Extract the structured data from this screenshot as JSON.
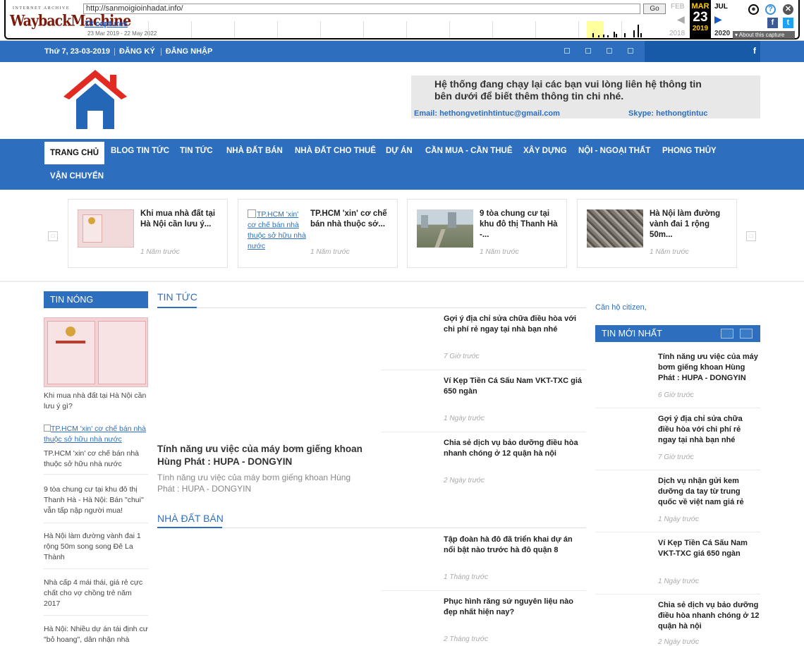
{
  "wayback": {
    "ia_label": "INTERNET ARCHIVE",
    "logo_text": "WaybackMachine",
    "url": "http://sanmoigioinhadat.info/",
    "go_label": "Go",
    "captures": "78 captures",
    "date_range": "23 Mar 2019 - 22 May 2022",
    "prev_month": "FEB",
    "cur_month": "MAR",
    "cur_day": "23",
    "next_month": "JUL",
    "prev_year": "2018",
    "cur_year": "2019",
    "next_year": "2020",
    "about": "About this capture",
    "icons": [
      "user-icon",
      "help-icon",
      "close-icon",
      "facebook-icon",
      "twitter-icon"
    ]
  },
  "topbar": {
    "date": "Thứ 7, 23-03-2019",
    "register": "ĐĂNG KÝ",
    "login": "ĐĂNG NHẬP",
    "search_icon": "f"
  },
  "banner": {
    "message": "Hệ thống đang chạy lại các bạn vui lòng liên hệ thông tin bên dưới để biết thêm thông tin chi nhé.",
    "email": "Email: hethongvetinhtintuc@gmail.com",
    "skype": "Skype: hethongtintuc"
  },
  "nav": {
    "items": [
      "TRANG CHỦ",
      "BLOG TIN TỨC",
      "TIN TỨC",
      "NHÀ ĐẤT BÁN",
      "NHÀ ĐẤT CHO THUÊ",
      "DỰ ÁN",
      "CẦN MUA - CẦN THUÊ",
      "XÂY DỰNG",
      "NỘI - NGOẠI THẤT",
      "PHONG THỦY",
      "VẬN CHUYỂN"
    ]
  },
  "carousel": [
    {
      "title": "Khi mua nhà đất tại Hà Nội cần lưu ý...",
      "time": "1 Năm trước"
    },
    {
      "alt": "TP.HCM 'xin' cơ chế bán nhà thuộc sở hữu nhà nước",
      "title": "TP.HCM 'xin' cơ chế bán nhà thuộc sở...",
      "time": "1 Năm trước"
    },
    {
      "title": "9 tòa chung cư tại khu đô thị Thanh Hà -...",
      "time": "1 Năm trước"
    },
    {
      "title": "Hà Nội làm đường vành đai 1 rộng 50m...",
      "time": "1 Năm trước"
    }
  ],
  "left": {
    "heading": "TIN NÓNG",
    "items": [
      "Khi mua nhà đất tại Hà Nội cần lưu ý gì?",
      "TP.HCM 'xin' cơ chế bán nhà thuộc sở hữu nhà nước",
      "TP.HCM 'xin' cơ chế bán nhà thuộc sở hữu nhà nước",
      "9 tòa chung cư tại khu đô thị Thanh Hà - Hà Nội: Bán \"chui\" vẫn tấp nập người mua!",
      "Hà Nội làm đường vành đai 1 rộng 50m song song Đê La Thành",
      "Nhà cấp 4 mái thái, giá rẻ cực chất cho vợ chồng trẻ năm 2017",
      "Hà Nội: Nhiều dự án tái định cư \"bỏ hoang\", dân nhận nhà"
    ]
  },
  "middle": {
    "section1": "TIN TỨC",
    "big_title": "Tính năng ưu việc của máy bơm giếng khoan Hùng Phát : HUPA - DONGYIN",
    "big_desc": "Tính năng ưu việc của máy bơm giếng khoan Hùng Phát : HUPA - DONGYIN",
    "posts1": [
      {
        "title": "Gợi ý địa chỉ sửa chữa điều hòa với chi phí rẻ ngay tại nhà bạn nhé",
        "time": "7 Giờ trước"
      },
      {
        "title": "Ví Kẹp Tiền Cá Sấu Nam VKT-TXC giá 650 ngàn",
        "time": "1 Ngày trước"
      },
      {
        "title": "Chia sẻ dịch vụ bảo dưỡng điều hòa nhanh chóng ở 12 quận hà nội",
        "time": "2 Ngày trước"
      }
    ],
    "section2": "NHÀ ĐẤT BÁN",
    "posts2": [
      {
        "title": "Tập đoàn hà đô đã triển khai dự án nổi bật nào trước hà đô quận 8",
        "time": "1 Tháng trước"
      },
      {
        "title": "Phục hình răng sứ nguyên liệu nào đẹp nhất hiện nay?",
        "time": "2 Tháng trước"
      }
    ]
  },
  "right": {
    "citizen": "Căn hộ citizen,",
    "heading": "TIN MỚI NHẤT",
    "posts": [
      {
        "title": "Tính năng ưu việc của máy bơm giếng khoan Hùng Phát : HUPA - DONGYIN",
        "time": "6 Giờ trước"
      },
      {
        "title": "Gợi ý địa chỉ sửa chữa điều hòa với chi phí rẻ ngay tại nhà bạn nhé",
        "time": "7 Giờ trước"
      },
      {
        "title": "Dịch vụ nhận gửi kem dưỡng da tay từ trung quốc về việt nam giá rẻ",
        "time": "1 Ngày trước"
      },
      {
        "title": "Ví Kẹp Tiền Cá Sấu Nam VKT-TXC giá 650 ngàn",
        "time": "1 Ngày trước"
      },
      {
        "title": "Chia sẻ dịch vụ bảo dưỡng điều hòa nhanh chóng ở 12 quận hà nội",
        "time": "2 Ngày trước"
      }
    ]
  },
  "colors": {
    "brand_blue": "#2d6fbe",
    "roof_red": "#e02a22",
    "wayback_yellow": "#ffcc00"
  }
}
